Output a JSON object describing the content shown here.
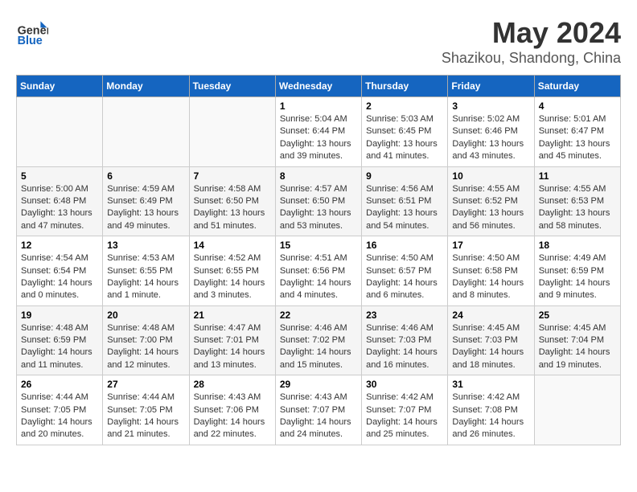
{
  "header": {
    "logo_general": "General",
    "logo_blue": "Blue",
    "main_title": "May 2024",
    "sub_title": "Shazikou, Shandong, China"
  },
  "days_of_week": [
    "Sunday",
    "Monday",
    "Tuesday",
    "Wednesday",
    "Thursday",
    "Friday",
    "Saturday"
  ],
  "weeks": [
    [
      {
        "day": "",
        "info": ""
      },
      {
        "day": "",
        "info": ""
      },
      {
        "day": "",
        "info": ""
      },
      {
        "day": "1",
        "info": "Sunrise: 5:04 AM\nSunset: 6:44 PM\nDaylight: 13 hours and 39 minutes."
      },
      {
        "day": "2",
        "info": "Sunrise: 5:03 AM\nSunset: 6:45 PM\nDaylight: 13 hours and 41 minutes."
      },
      {
        "day": "3",
        "info": "Sunrise: 5:02 AM\nSunset: 6:46 PM\nDaylight: 13 hours and 43 minutes."
      },
      {
        "day": "4",
        "info": "Sunrise: 5:01 AM\nSunset: 6:47 PM\nDaylight: 13 hours and 45 minutes."
      }
    ],
    [
      {
        "day": "5",
        "info": "Sunrise: 5:00 AM\nSunset: 6:48 PM\nDaylight: 13 hours and 47 minutes."
      },
      {
        "day": "6",
        "info": "Sunrise: 4:59 AM\nSunset: 6:49 PM\nDaylight: 13 hours and 49 minutes."
      },
      {
        "day": "7",
        "info": "Sunrise: 4:58 AM\nSunset: 6:50 PM\nDaylight: 13 hours and 51 minutes."
      },
      {
        "day": "8",
        "info": "Sunrise: 4:57 AM\nSunset: 6:50 PM\nDaylight: 13 hours and 53 minutes."
      },
      {
        "day": "9",
        "info": "Sunrise: 4:56 AM\nSunset: 6:51 PM\nDaylight: 13 hours and 54 minutes."
      },
      {
        "day": "10",
        "info": "Sunrise: 4:55 AM\nSunset: 6:52 PM\nDaylight: 13 hours and 56 minutes."
      },
      {
        "day": "11",
        "info": "Sunrise: 4:55 AM\nSunset: 6:53 PM\nDaylight: 13 hours and 58 minutes."
      }
    ],
    [
      {
        "day": "12",
        "info": "Sunrise: 4:54 AM\nSunset: 6:54 PM\nDaylight: 14 hours and 0 minutes."
      },
      {
        "day": "13",
        "info": "Sunrise: 4:53 AM\nSunset: 6:55 PM\nDaylight: 14 hours and 1 minute."
      },
      {
        "day": "14",
        "info": "Sunrise: 4:52 AM\nSunset: 6:55 PM\nDaylight: 14 hours and 3 minutes."
      },
      {
        "day": "15",
        "info": "Sunrise: 4:51 AM\nSunset: 6:56 PM\nDaylight: 14 hours and 4 minutes."
      },
      {
        "day": "16",
        "info": "Sunrise: 4:50 AM\nSunset: 6:57 PM\nDaylight: 14 hours and 6 minutes."
      },
      {
        "day": "17",
        "info": "Sunrise: 4:50 AM\nSunset: 6:58 PM\nDaylight: 14 hours and 8 minutes."
      },
      {
        "day": "18",
        "info": "Sunrise: 4:49 AM\nSunset: 6:59 PM\nDaylight: 14 hours and 9 minutes."
      }
    ],
    [
      {
        "day": "19",
        "info": "Sunrise: 4:48 AM\nSunset: 6:59 PM\nDaylight: 14 hours and 11 minutes."
      },
      {
        "day": "20",
        "info": "Sunrise: 4:48 AM\nSunset: 7:00 PM\nDaylight: 14 hours and 12 minutes."
      },
      {
        "day": "21",
        "info": "Sunrise: 4:47 AM\nSunset: 7:01 PM\nDaylight: 14 hours and 13 minutes."
      },
      {
        "day": "22",
        "info": "Sunrise: 4:46 AM\nSunset: 7:02 PM\nDaylight: 14 hours and 15 minutes."
      },
      {
        "day": "23",
        "info": "Sunrise: 4:46 AM\nSunset: 7:03 PM\nDaylight: 14 hours and 16 minutes."
      },
      {
        "day": "24",
        "info": "Sunrise: 4:45 AM\nSunset: 7:03 PM\nDaylight: 14 hours and 18 minutes."
      },
      {
        "day": "25",
        "info": "Sunrise: 4:45 AM\nSunset: 7:04 PM\nDaylight: 14 hours and 19 minutes."
      }
    ],
    [
      {
        "day": "26",
        "info": "Sunrise: 4:44 AM\nSunset: 7:05 PM\nDaylight: 14 hours and 20 minutes."
      },
      {
        "day": "27",
        "info": "Sunrise: 4:44 AM\nSunset: 7:05 PM\nDaylight: 14 hours and 21 minutes."
      },
      {
        "day": "28",
        "info": "Sunrise: 4:43 AM\nSunset: 7:06 PM\nDaylight: 14 hours and 22 minutes."
      },
      {
        "day": "29",
        "info": "Sunrise: 4:43 AM\nSunset: 7:07 PM\nDaylight: 14 hours and 24 minutes."
      },
      {
        "day": "30",
        "info": "Sunrise: 4:42 AM\nSunset: 7:07 PM\nDaylight: 14 hours and 25 minutes."
      },
      {
        "day": "31",
        "info": "Sunrise: 4:42 AM\nSunset: 7:08 PM\nDaylight: 14 hours and 26 minutes."
      },
      {
        "day": "",
        "info": ""
      }
    ]
  ]
}
